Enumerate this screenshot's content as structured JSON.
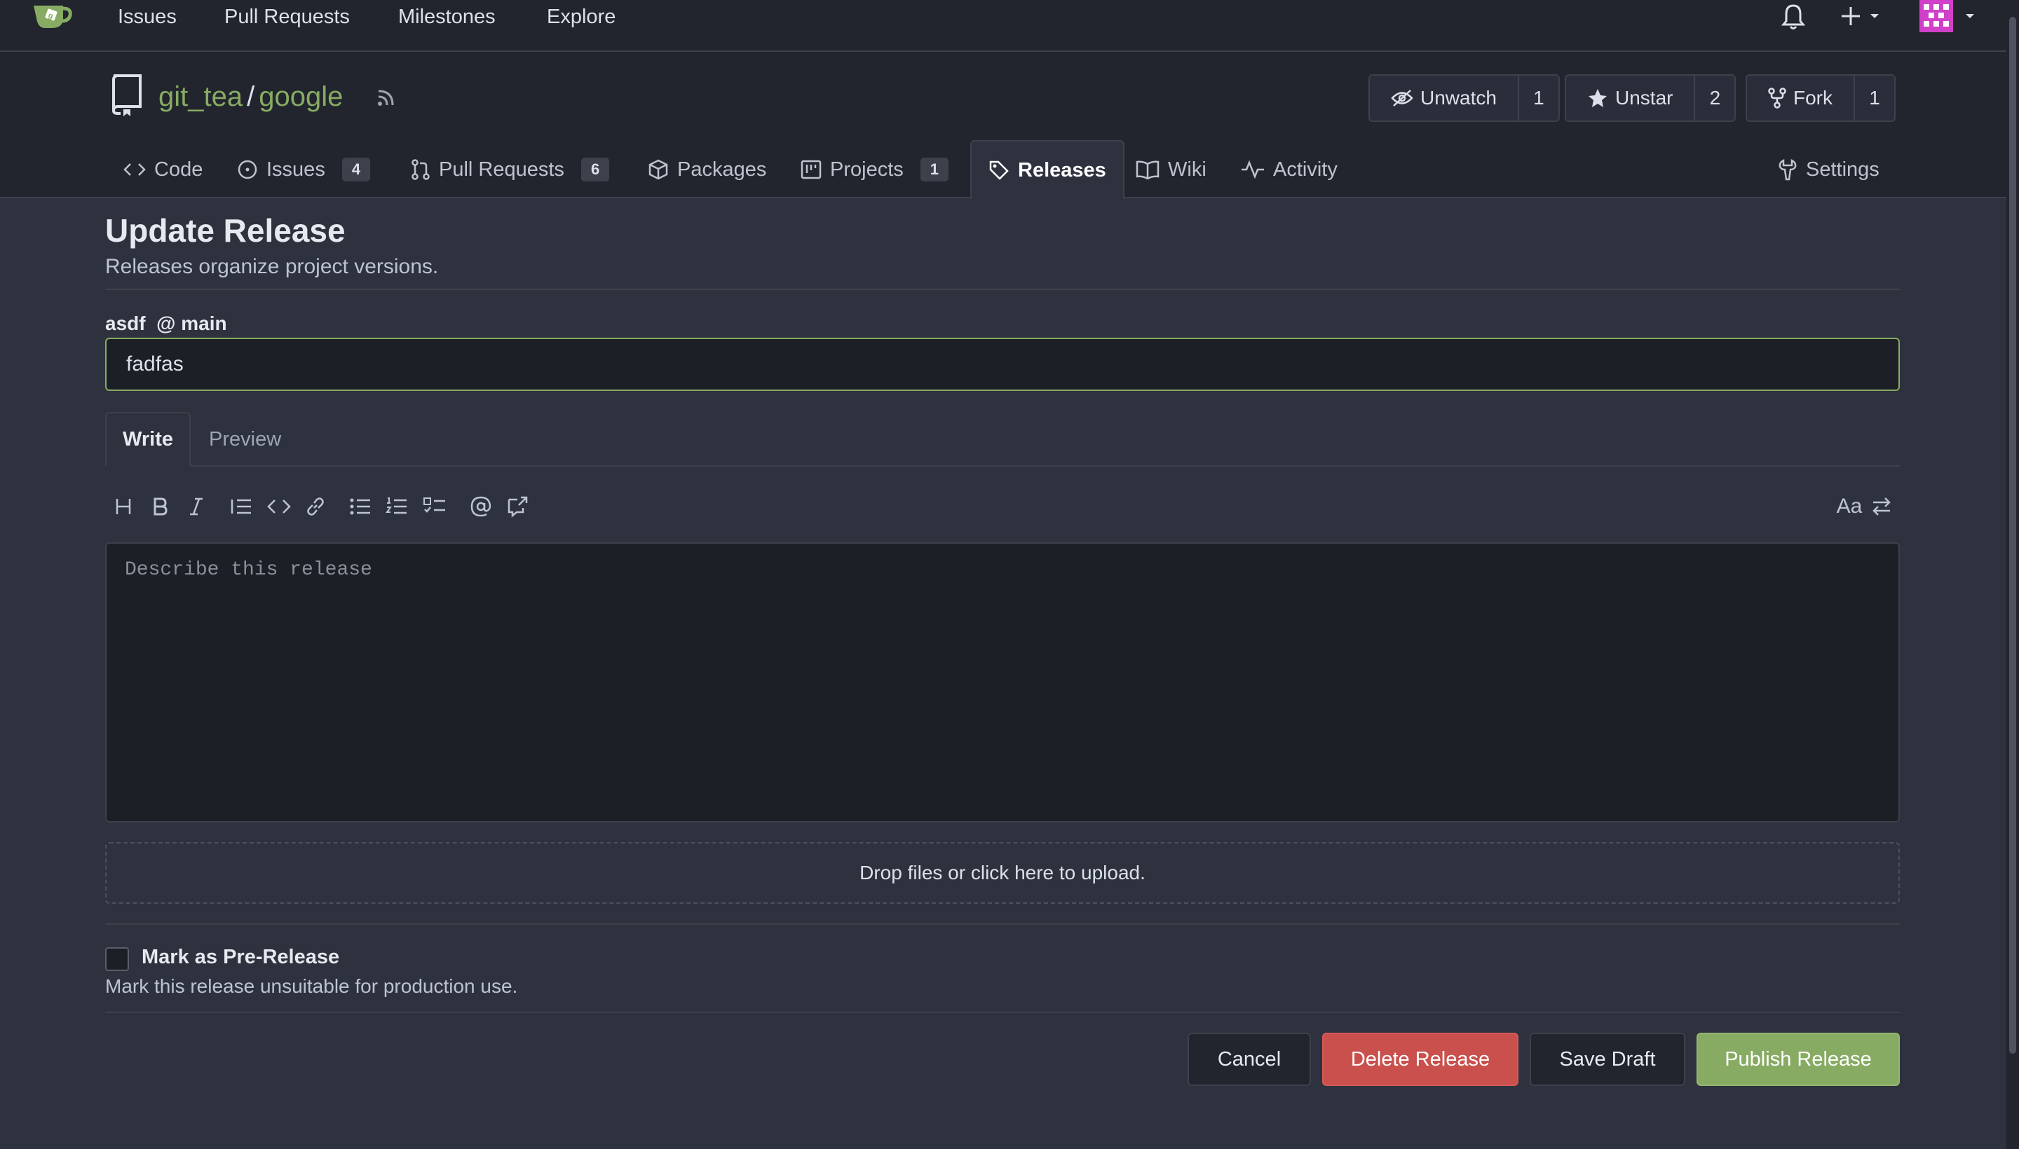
{
  "topnav": {
    "links": [
      "Issues",
      "Pull Requests",
      "Milestones",
      "Explore"
    ]
  },
  "repo": {
    "owner": "git_tea",
    "separator": "/",
    "name": "google",
    "watch": {
      "label": "Unwatch",
      "count": "1"
    },
    "star": {
      "label": "Unstar",
      "count": "2"
    },
    "fork": {
      "label": "Fork",
      "count": "1"
    }
  },
  "tabs": {
    "code": {
      "label": "Code"
    },
    "issues": {
      "label": "Issues",
      "count": "4"
    },
    "pulls": {
      "label": "Pull Requests",
      "count": "6"
    },
    "packages": {
      "label": "Packages"
    },
    "projects": {
      "label": "Projects",
      "count": "1"
    },
    "releases": {
      "label": "Releases"
    },
    "wiki": {
      "label": "Wiki"
    },
    "activity": {
      "label": "Activity"
    },
    "settings": {
      "label": "Settings"
    }
  },
  "page": {
    "title": "Update Release",
    "subtitle": "Releases organize project versions.",
    "tag": "asdf",
    "target_prefix": "@",
    "target": "main"
  },
  "form": {
    "title_value": "fadfas",
    "editor_tabs": {
      "write": "Write",
      "preview": "Preview"
    },
    "toolbar": {
      "font_toggle": "Aa"
    },
    "content_placeholder": "Describe this release",
    "dropzone_text": "Drop files or click here to upload.",
    "prerelease": {
      "label": "Mark as Pre-Release",
      "help": "Mark this release unsuitable for production use."
    }
  },
  "actions": {
    "cancel": "Cancel",
    "delete": "Delete Release",
    "save_draft": "Save Draft",
    "publish": "Publish Release"
  },
  "colors": {
    "accent_green": "#87ab63",
    "danger_red": "#c9504c",
    "background": "#2e323e",
    "header_background": "#22252d"
  }
}
